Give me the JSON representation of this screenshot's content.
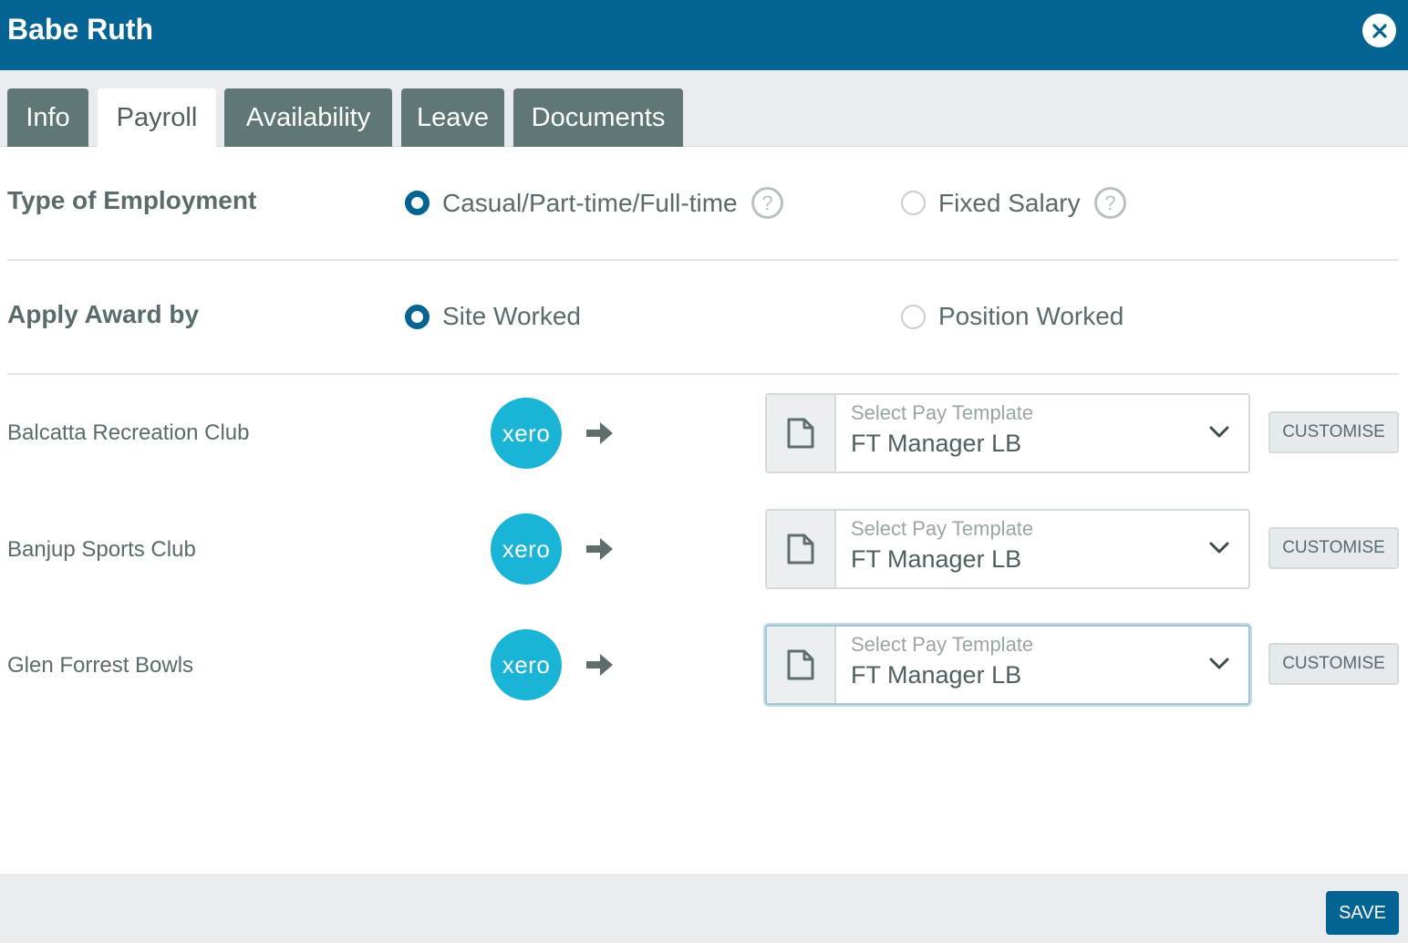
{
  "header": {
    "title": "Babe Ruth",
    "close_icon": "close-icon"
  },
  "tabs": [
    {
      "label": "Info",
      "active": false
    },
    {
      "label": "Payroll",
      "active": true
    },
    {
      "label": "Availability",
      "active": false
    },
    {
      "label": "Leave",
      "active": false
    },
    {
      "label": "Documents",
      "active": false
    }
  ],
  "employment": {
    "label": "Type of Employment",
    "options": [
      {
        "label": "Casual/Part-time/Full-time",
        "checked": true,
        "help_icon": "help-icon"
      },
      {
        "label": "Fixed Salary",
        "checked": false,
        "help_icon": "help-icon"
      }
    ]
  },
  "award": {
    "label": "Apply Award by",
    "options": [
      {
        "label": "Site Worked",
        "checked": true
      },
      {
        "label": "Position Worked",
        "checked": false
      }
    ]
  },
  "sites": [
    {
      "name": "Balcatta Recreation Club",
      "logo": "xero",
      "template_placeholder": "Select Pay Template",
      "template_value": "FT Manager LB",
      "customise_label": "CUSTOMISE"
    },
    {
      "name": "Banjup Sports Club",
      "logo": "xero",
      "template_placeholder": "Select Pay Template",
      "template_value": "FT Manager LB",
      "customise_label": "CUSTOMISE"
    },
    {
      "name": "Glen Forrest Bowls",
      "logo": "xero",
      "template_placeholder": "Select Pay Template",
      "template_value": "FT Manager LB",
      "customise_label": "CUSTOMISE"
    }
  ],
  "footer": {
    "save_label": "SAVE"
  },
  "colors": {
    "primary": "#036494",
    "tab_inactive": "#5f7775",
    "xero": "#1ab4d7",
    "text": "#5a6b6b"
  }
}
